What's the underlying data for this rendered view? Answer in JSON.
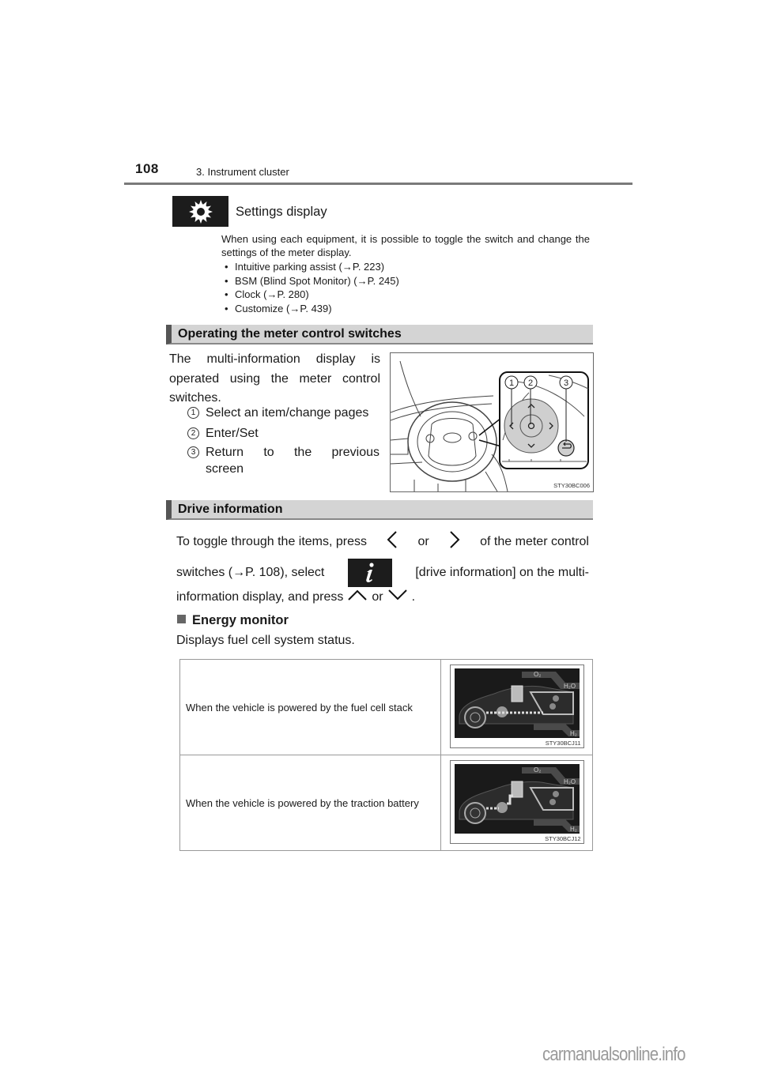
{
  "header": {
    "page_number": "108",
    "chapter": "3. Instrument cluster"
  },
  "settings_display": {
    "icon": "gear-icon",
    "title": "Settings display",
    "description": "When using each equipment, it is possible to toggle the switch and change the settings of the meter display.",
    "items": [
      "Intuitive parking assist (→P. 223)",
      "BSM (Blind Spot Monitor) (→P. 245)",
      "Clock (→P. 280)",
      "Customize (→P. 439)"
    ]
  },
  "operating_section": {
    "heading": "Operating the meter control switches",
    "intro": "The multi-information display is operated using the meter control switches.",
    "items": [
      {
        "num": "1",
        "text": "Select an item/change pages"
      },
      {
        "num": "2",
        "text": "Enter/Set"
      },
      {
        "num": "3",
        "text": "Return to the previous",
        "text_cont": "screen"
      }
    ],
    "figure": {
      "callouts": [
        "1",
        "2",
        "3"
      ],
      "code": "STY30BC006"
    }
  },
  "drive_section": {
    "heading": "Drive information",
    "line1": {
      "a": "To toggle through the items, press",
      "or": "or",
      "b": "of the meter control"
    },
    "line2": {
      "a": "switches (→P. 108), select",
      "icon": "info-icon",
      "icon_glyph": "i",
      "b": "[drive information] on the multi-"
    },
    "line3": {
      "a": "information display, and press",
      "or": "or",
      "end": "."
    },
    "subheading": "Energy monitor",
    "description": "Displays fuel cell system status.",
    "table": [
      {
        "text": "When the vehicle is powered by the fuel cell stack",
        "code": "STY30BCJ11",
        "labels": [
          "O₂",
          "H₂O",
          "H₂"
        ]
      },
      {
        "text": "When the vehicle is powered by the traction battery",
        "code": "STY30BCJ12",
        "labels": [
          "O₂",
          "H₂O",
          "H₂"
        ]
      }
    ]
  },
  "watermark": "carmanualsonline.info"
}
